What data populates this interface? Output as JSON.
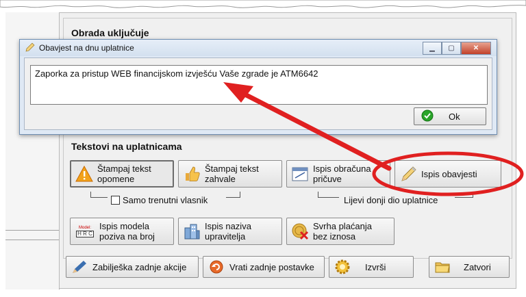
{
  "main": {
    "section_processing_title": "Obrada uključuje",
    "section_texts_title": "Tekstovi na uplatnicama",
    "buttons_row1": [
      {
        "label": "Štampaj tekst\nopomene",
        "icon": "warning-icon"
      },
      {
        "label": "Štampaj tekst\nzahvale",
        "icon": "thumbs-up-icon"
      },
      {
        "label": "Ispis obračuna\npričuve",
        "icon": "calendar-icon"
      },
      {
        "label": "Ispis obavjesti",
        "icon": "pencil-icon"
      }
    ],
    "checkbox_label": "Samo trenutni vlasnik",
    "bottom_left_label": "Lijevi donji dio uplatnice",
    "buttons_row2": [
      {
        "label": "Ispis modela\npoziva na broj",
        "icon": "model-icon",
        "icon_text": "Model:",
        "icon_letters": "H R C"
      },
      {
        "label": "Ispis naziva\nupravitelja",
        "icon": "buildings-icon"
      },
      {
        "label": "Svrha plaćanja\nbez iznosa",
        "icon": "coin-cross-icon"
      }
    ],
    "bottom_buttons": [
      {
        "label": "Zabilješka zadnje akcije",
        "icon": "pen-icon"
      },
      {
        "label": "Vrati zadnje postavke",
        "icon": "undo-icon"
      },
      {
        "label": "Izvrši",
        "icon": "gear-icon"
      },
      {
        "label": "Zatvori",
        "icon": "folder-icon"
      }
    ]
  },
  "dialog": {
    "title": "Obavjest na dnu uplatnice",
    "message": "Zaporka za pristup WEB financijskom izvješću Vaše zgrade je ATM6642",
    "ok_label": "Ok"
  },
  "colors": {
    "annotation_red": "#e02020",
    "ok_green": "#2aa52a"
  }
}
